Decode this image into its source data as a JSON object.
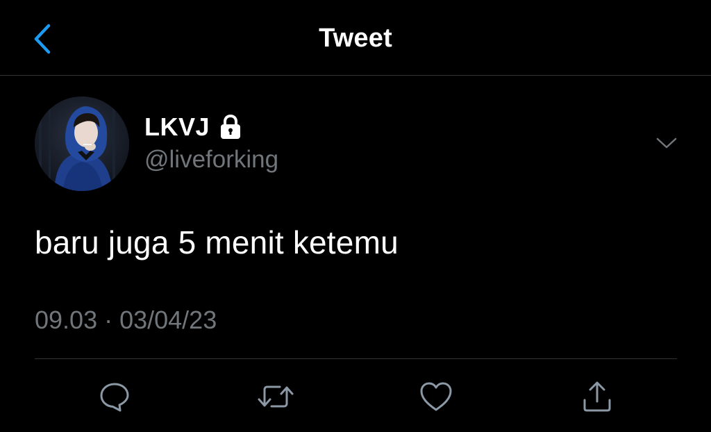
{
  "header": {
    "title": "Tweet",
    "back_icon": "chevron-left-icon"
  },
  "author": {
    "display_name": "LKVJ",
    "handle": "@liveforking",
    "protected_icon": "lock-icon",
    "menu_icon": "chevron-down-icon"
  },
  "tweet": {
    "text": "baru juga 5 menit ketemu",
    "timestamp": "09.03 · 03/04/23"
  },
  "actions": [
    {
      "name": "reply",
      "icon": "speech-bubble-icon"
    },
    {
      "name": "retweet",
      "icon": "retweet-icon"
    },
    {
      "name": "like",
      "icon": "heart-icon"
    },
    {
      "name": "share",
      "icon": "share-icon"
    }
  ],
  "colors": {
    "background": "#000000",
    "accent": "#1d9bf0",
    "primary_text": "#ffffff",
    "secondary_text": "#71767b",
    "divider": "#2f3336"
  }
}
